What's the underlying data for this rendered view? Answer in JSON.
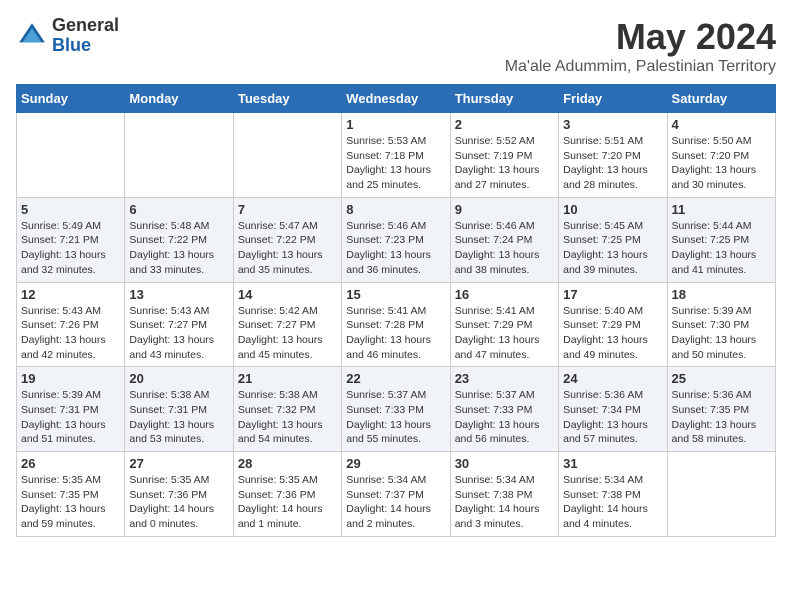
{
  "header": {
    "logo": {
      "general": "General",
      "blue": "Blue"
    },
    "title": "May 2024",
    "location": "Ma'ale Adummim, Palestinian Territory"
  },
  "days_of_week": [
    "Sunday",
    "Monday",
    "Tuesday",
    "Wednesday",
    "Thursday",
    "Friday",
    "Saturday"
  ],
  "weeks": [
    [
      {
        "day": "",
        "info": ""
      },
      {
        "day": "",
        "info": ""
      },
      {
        "day": "",
        "info": ""
      },
      {
        "day": "1",
        "info": "Sunrise: 5:53 AM\nSunset: 7:18 PM\nDaylight: 13 hours\nand 25 minutes."
      },
      {
        "day": "2",
        "info": "Sunrise: 5:52 AM\nSunset: 7:19 PM\nDaylight: 13 hours\nand 27 minutes."
      },
      {
        "day": "3",
        "info": "Sunrise: 5:51 AM\nSunset: 7:20 PM\nDaylight: 13 hours\nand 28 minutes."
      },
      {
        "day": "4",
        "info": "Sunrise: 5:50 AM\nSunset: 7:20 PM\nDaylight: 13 hours\nand 30 minutes."
      }
    ],
    [
      {
        "day": "5",
        "info": "Sunrise: 5:49 AM\nSunset: 7:21 PM\nDaylight: 13 hours\nand 32 minutes."
      },
      {
        "day": "6",
        "info": "Sunrise: 5:48 AM\nSunset: 7:22 PM\nDaylight: 13 hours\nand 33 minutes."
      },
      {
        "day": "7",
        "info": "Sunrise: 5:47 AM\nSunset: 7:22 PM\nDaylight: 13 hours\nand 35 minutes."
      },
      {
        "day": "8",
        "info": "Sunrise: 5:46 AM\nSunset: 7:23 PM\nDaylight: 13 hours\nand 36 minutes."
      },
      {
        "day": "9",
        "info": "Sunrise: 5:46 AM\nSunset: 7:24 PM\nDaylight: 13 hours\nand 38 minutes."
      },
      {
        "day": "10",
        "info": "Sunrise: 5:45 AM\nSunset: 7:25 PM\nDaylight: 13 hours\nand 39 minutes."
      },
      {
        "day": "11",
        "info": "Sunrise: 5:44 AM\nSunset: 7:25 PM\nDaylight: 13 hours\nand 41 minutes."
      }
    ],
    [
      {
        "day": "12",
        "info": "Sunrise: 5:43 AM\nSunset: 7:26 PM\nDaylight: 13 hours\nand 42 minutes."
      },
      {
        "day": "13",
        "info": "Sunrise: 5:43 AM\nSunset: 7:27 PM\nDaylight: 13 hours\nand 43 minutes."
      },
      {
        "day": "14",
        "info": "Sunrise: 5:42 AM\nSunset: 7:27 PM\nDaylight: 13 hours\nand 45 minutes."
      },
      {
        "day": "15",
        "info": "Sunrise: 5:41 AM\nSunset: 7:28 PM\nDaylight: 13 hours\nand 46 minutes."
      },
      {
        "day": "16",
        "info": "Sunrise: 5:41 AM\nSunset: 7:29 PM\nDaylight: 13 hours\nand 47 minutes."
      },
      {
        "day": "17",
        "info": "Sunrise: 5:40 AM\nSunset: 7:29 PM\nDaylight: 13 hours\nand 49 minutes."
      },
      {
        "day": "18",
        "info": "Sunrise: 5:39 AM\nSunset: 7:30 PM\nDaylight: 13 hours\nand 50 minutes."
      }
    ],
    [
      {
        "day": "19",
        "info": "Sunrise: 5:39 AM\nSunset: 7:31 PM\nDaylight: 13 hours\nand 51 minutes."
      },
      {
        "day": "20",
        "info": "Sunrise: 5:38 AM\nSunset: 7:31 PM\nDaylight: 13 hours\nand 53 minutes."
      },
      {
        "day": "21",
        "info": "Sunrise: 5:38 AM\nSunset: 7:32 PM\nDaylight: 13 hours\nand 54 minutes."
      },
      {
        "day": "22",
        "info": "Sunrise: 5:37 AM\nSunset: 7:33 PM\nDaylight: 13 hours\nand 55 minutes."
      },
      {
        "day": "23",
        "info": "Sunrise: 5:37 AM\nSunset: 7:33 PM\nDaylight: 13 hours\nand 56 minutes."
      },
      {
        "day": "24",
        "info": "Sunrise: 5:36 AM\nSunset: 7:34 PM\nDaylight: 13 hours\nand 57 minutes."
      },
      {
        "day": "25",
        "info": "Sunrise: 5:36 AM\nSunset: 7:35 PM\nDaylight: 13 hours\nand 58 minutes."
      }
    ],
    [
      {
        "day": "26",
        "info": "Sunrise: 5:35 AM\nSunset: 7:35 PM\nDaylight: 13 hours\nand 59 minutes."
      },
      {
        "day": "27",
        "info": "Sunrise: 5:35 AM\nSunset: 7:36 PM\nDaylight: 14 hours\nand 0 minutes."
      },
      {
        "day": "28",
        "info": "Sunrise: 5:35 AM\nSunset: 7:36 PM\nDaylight: 14 hours\nand 1 minute."
      },
      {
        "day": "29",
        "info": "Sunrise: 5:34 AM\nSunset: 7:37 PM\nDaylight: 14 hours\nand 2 minutes."
      },
      {
        "day": "30",
        "info": "Sunrise: 5:34 AM\nSunset: 7:38 PM\nDaylight: 14 hours\nand 3 minutes."
      },
      {
        "day": "31",
        "info": "Sunrise: 5:34 AM\nSunset: 7:38 PM\nDaylight: 14 hours\nand 4 minutes."
      },
      {
        "day": "",
        "info": ""
      }
    ]
  ]
}
